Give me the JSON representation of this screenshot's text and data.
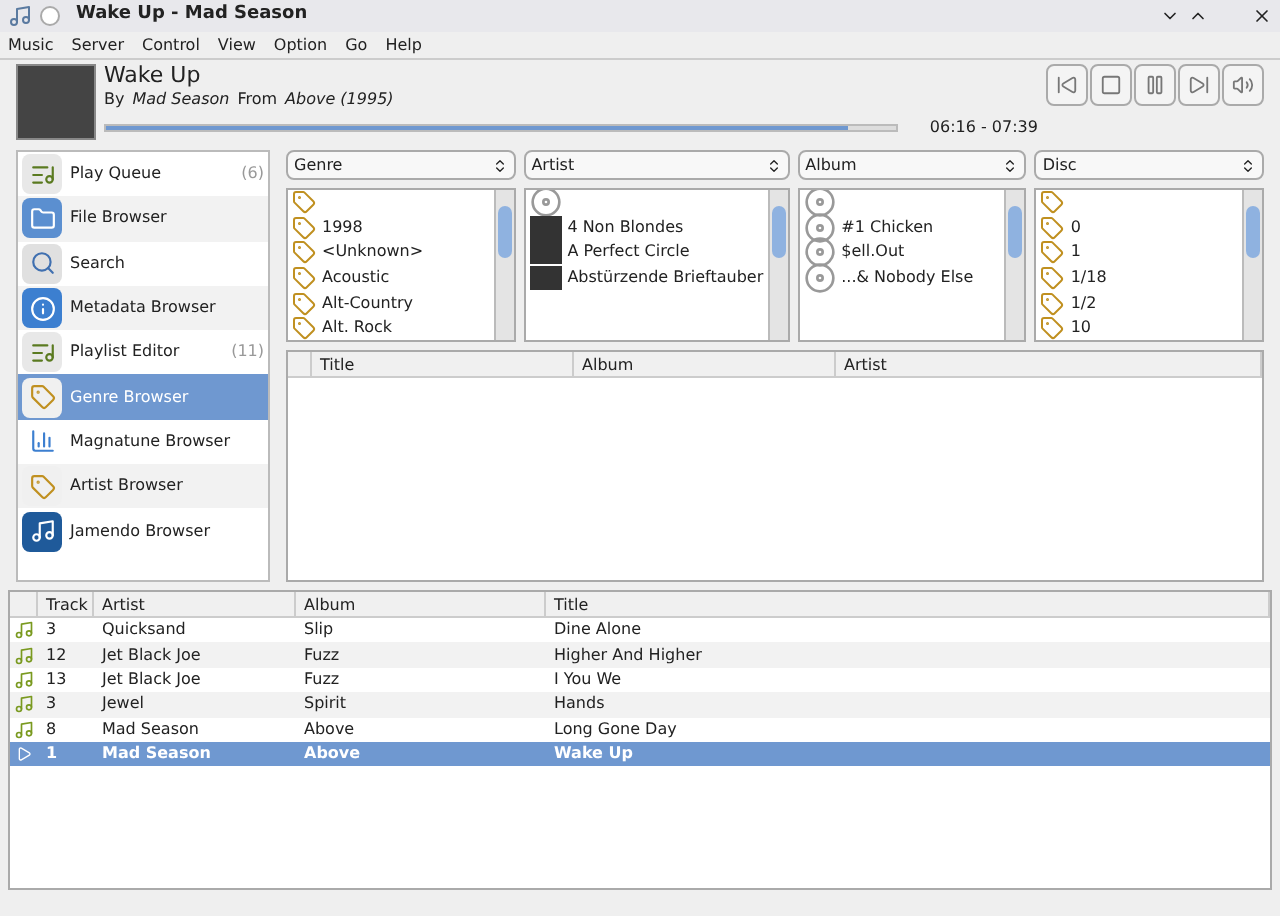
{
  "window": {
    "title": "Wake Up - Mad Season"
  },
  "menu": [
    "Music",
    "Server",
    "Control",
    "View",
    "Option",
    "Go",
    "Help"
  ],
  "now_playing": {
    "title": "Wake Up",
    "by_label": "By",
    "artist": "Mad Season",
    "from_label": "From",
    "album": "Above (1995)",
    "time": "06:16 - 07:39",
    "progress": {
      "level": 0.94
    }
  },
  "sidebar": {
    "items": [
      {
        "label": "Play Queue",
        "count": "(6)",
        "selected": false
      },
      {
        "label": "File Browser",
        "selected": false
      },
      {
        "label": "Search",
        "selected": false
      },
      {
        "label": "Metadata Browser",
        "selected": false
      },
      {
        "label": "Playlist Editor",
        "count": "(11)",
        "selected": false
      },
      {
        "label": "Genre Browser",
        "selected": true
      },
      {
        "label": "Magnatune Browser",
        "selected": false
      },
      {
        "label": "Artist Browser",
        "selected": false
      },
      {
        "label": "Jamendo Browser",
        "selected": false
      }
    ]
  },
  "filters": [
    {
      "label": "Genre",
      "items": [
        {
          "kind": "tag"
        },
        {
          "kind": "tag",
          "text": "1998"
        },
        {
          "kind": "tag",
          "text": "<Unknown>"
        },
        {
          "kind": "tag",
          "text": "Acoustic"
        },
        {
          "kind": "tag",
          "text": "Alt-Country"
        },
        {
          "kind": "tag",
          "text": "Alt. Rock"
        }
      ]
    },
    {
      "label": "Artist",
      "items": [
        {
          "kind": "disc"
        },
        {
          "kind": "photo",
          "text": "4 Non Blondes"
        },
        {
          "kind": "photo",
          "text": "A Perfect Circle"
        },
        {
          "kind": "photo",
          "text": "Abstürzende Brieftauber"
        }
      ]
    },
    {
      "label": "Album",
      "items": [
        {
          "kind": "disc"
        },
        {
          "kind": "disc",
          "text": "#1 Chicken"
        },
        {
          "kind": "disc",
          "text": "$ell.Out"
        },
        {
          "kind": "disc",
          "text": "...& Nobody Else"
        }
      ]
    },
    {
      "label": "Disc",
      "items": [
        {
          "kind": "tag"
        },
        {
          "kind": "tag",
          "text": "0"
        },
        {
          "kind": "tag",
          "text": "1"
        },
        {
          "kind": "tag",
          "text": "1/18"
        },
        {
          "kind": "tag",
          "text": "1/2"
        },
        {
          "kind": "tag",
          "text": "10"
        }
      ]
    }
  ],
  "songs_table": {
    "columns": [
      "Title",
      "Album",
      "Artist"
    ]
  },
  "playlist": {
    "columns": [
      "Track",
      "Artist",
      "Album",
      "Title"
    ],
    "rows": [
      {
        "kind": "song",
        "selected": false,
        "track": "3",
        "artist": "Quicksand",
        "album": "Slip",
        "title": "Dine Alone"
      },
      {
        "kind": "song",
        "selected": false,
        "track": "12",
        "artist": "Jet Black Joe",
        "album": "Fuzz",
        "title": "Higher And Higher"
      },
      {
        "kind": "song",
        "selected": false,
        "track": "13",
        "artist": "Jet Black Joe",
        "album": "Fuzz",
        "title": "I You We"
      },
      {
        "kind": "song",
        "selected": false,
        "track": "3",
        "artist": "Jewel",
        "album": "Spirit",
        "title": "Hands"
      },
      {
        "kind": "song",
        "selected": false,
        "track": "8",
        "artist": "Mad Season",
        "album": "Above",
        "title": "Long Gone Day"
      },
      {
        "kind": "playing",
        "selected": true,
        "track": "1",
        "artist": "Mad Season",
        "album": "Above",
        "title": "Wake Up"
      }
    ]
  }
}
